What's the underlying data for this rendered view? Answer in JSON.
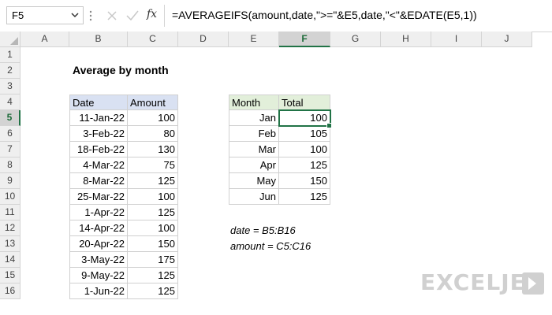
{
  "name_box": {
    "value": "F5"
  },
  "formula_bar": {
    "fx_label": "fx",
    "formula": "=AVERAGEIFS(amount,date,\">=\"&E5,date,\"<\"&EDATE(E5,1))"
  },
  "columns": [
    "A",
    "B",
    "C",
    "D",
    "E",
    "F",
    "G",
    "H",
    "I",
    "J"
  ],
  "rows": [
    "1",
    "2",
    "3",
    "4",
    "5",
    "6",
    "7",
    "8",
    "9",
    "10",
    "11",
    "12",
    "13",
    "14",
    "15",
    "16"
  ],
  "selected": {
    "column": "F",
    "row": "5"
  },
  "sheet": {
    "title": "Average by month",
    "left_table": {
      "headers": [
        "Date",
        "Amount"
      ],
      "rows": [
        [
          "11-Jan-22",
          "100"
        ],
        [
          "3-Feb-22",
          "80"
        ],
        [
          "18-Feb-22",
          "130"
        ],
        [
          "4-Mar-22",
          "75"
        ],
        [
          "8-Mar-22",
          "125"
        ],
        [
          "25-Mar-22",
          "100"
        ],
        [
          "1-Apr-22",
          "125"
        ],
        [
          "14-Apr-22",
          "100"
        ],
        [
          "20-Apr-22",
          "150"
        ],
        [
          "3-May-22",
          "175"
        ],
        [
          "9-May-22",
          "125"
        ],
        [
          "1-Jun-22",
          "125"
        ]
      ]
    },
    "right_table": {
      "headers": [
        "Month",
        "Total"
      ],
      "rows": [
        [
          "Jan",
          "100"
        ],
        [
          "Feb",
          "105"
        ],
        [
          "Mar",
          "100"
        ],
        [
          "Apr",
          "125"
        ],
        [
          "May",
          "150"
        ],
        [
          "Jun",
          "125"
        ]
      ]
    },
    "notes": [
      "date = B5:B16",
      "amount = C5:C16"
    ]
  },
  "watermark": "EXCELJET",
  "colors": {
    "accent": "#217346",
    "header_blue": "#d9e1f2",
    "header_green": "#e2efda"
  }
}
